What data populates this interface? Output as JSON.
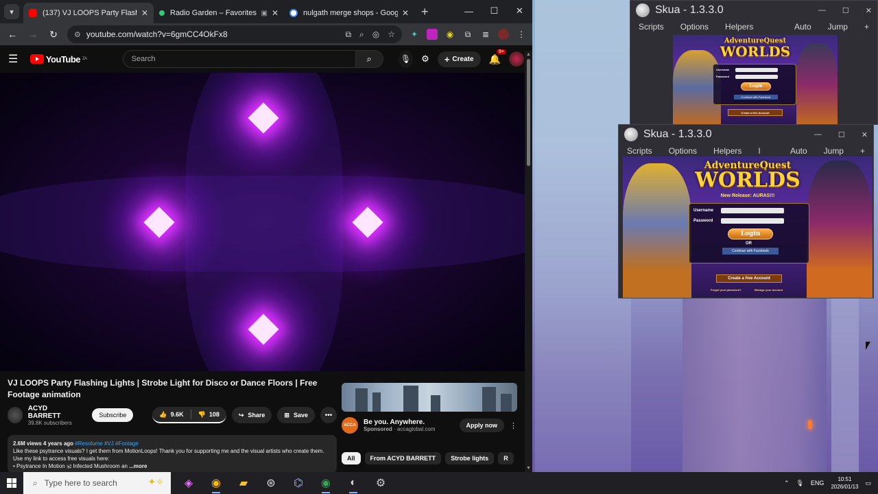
{
  "browser": {
    "tabs": [
      {
        "title": "(137) VJ LOOPS Party Flashing L",
        "active": true,
        "favicon_color": "#ff0000",
        "has_media": true
      },
      {
        "title": "Radio Garden – Favorites",
        "active": false,
        "favicon_color": "#2ecc71",
        "has_media": false
      },
      {
        "title": "nulgath merge shops - Google",
        "active": false,
        "favicon_color": "#4285f4",
        "has_media": false
      }
    ],
    "url": "youtube.com/watch?v=6gmCC4OkFx8"
  },
  "youtube": {
    "logo_text": "YouTube",
    "logo_region": "ZA",
    "search_placeholder": "Search",
    "create_label": "Create",
    "notification_count": "9+",
    "video_title": "VJ LOOPS Party Flashing Lights | Strobe Light for Disco or Dance Floors | Free Footage animation",
    "channel_name": "ACYD BARRETT",
    "subscribers": "39.8K subscribers",
    "subscribe_label": "Subscribe",
    "likes": "9.6K",
    "dislikes": "108",
    "share_label": "Share",
    "save_label": "Save",
    "desc_stats": "2.6M views  4 years ago",
    "desc_tags": "#Resolume #VJ #Footage",
    "desc_text": "Like these psytrance visuals? I get them from MotionLoops! Thank you for supporting me and the visual artists who create them. Use my link to access free visuals here:",
    "desc_line3": "• Psytrance In Motion 🕉 Infected Mushroom an",
    "desc_more": "...more",
    "ad": {
      "headline": "Be you. Anywhere.",
      "sponsor_label": "Sponsored",
      "sponsor_domain": "accaglobal.com",
      "logo_text": "ACCA",
      "cta": "Apply now"
    },
    "chips": [
      "All",
      "From ACYD BARRETT",
      "Strobe lights",
      "R"
    ]
  },
  "skua_windows": [
    {
      "title": "Skua - 1.3.3.0",
      "menu": [
        "Scripts",
        "Options",
        "Helpers"
      ],
      "menu_right": [
        "Auto",
        "Jump",
        "+"
      ],
      "game_logo_top": "AdventureQuest",
      "game_logo_bottom": "WORLDS",
      "release_text": "New Release: AURAS!!!",
      "username_label": "Username",
      "password_label": "Password",
      "login_label": "Login",
      "facebook_label": "Continue with Facebook",
      "create_label": "Create a free Account"
    },
    {
      "title": "Skua - 1.3.3.0",
      "menu": [
        "Scripts",
        "Options",
        "Helpers",
        "I"
      ],
      "menu_right": [
        "Auto",
        "Jump",
        "+"
      ],
      "game_logo_top": "AdventureQuest",
      "game_logo_bottom": "WORLDS",
      "release_text": "New Release: AURAS!!!",
      "username_label": "Username",
      "password_label": "Password",
      "login_label": "Login",
      "or_label": "OR",
      "facebook_label": "Continue with Facebook",
      "create_label": "Create a free Account",
      "footer_left": "Forgot your password?",
      "footer_right": "Manage your account"
    }
  ],
  "taskbar": {
    "search_placeholder": "Type here to search",
    "language": "ENG",
    "time": "10:51",
    "date": "2026/01/13"
  }
}
